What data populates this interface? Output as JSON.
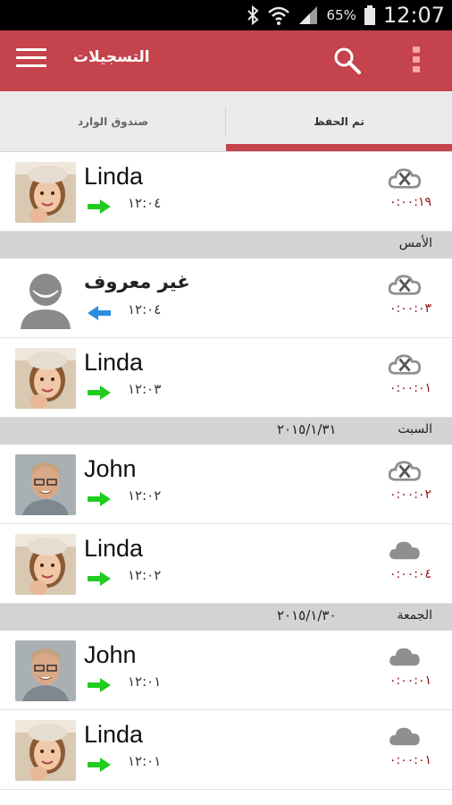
{
  "status_bar": {
    "time": "12:07",
    "battery": "65%"
  },
  "app_bar": {
    "title": "التسجيلات"
  },
  "tabs": [
    {
      "label": "صندوق الوارد",
      "selected": false
    },
    {
      "label": "تم الحفظ",
      "selected": true
    }
  ],
  "colors": {
    "accent": "#c5434c",
    "header_bg": "#d3d3d3",
    "duration": "#8e1010",
    "outgoing": "#20cc20",
    "incoming": "#2a8ee0",
    "cloud": "#8f8f8f"
  },
  "list": [
    {
      "type": "call",
      "name": "Linda",
      "time": "١٢:٠٤",
      "duration": "٠:٠٠:١٩",
      "direction": "outgoing",
      "cloud": "cloud-off-icon",
      "avatar": "linda"
    },
    {
      "type": "header",
      "day": "الأمس",
      "date": ""
    },
    {
      "type": "call",
      "name": "غير معروف",
      "time": "١٢:٠٤",
      "duration": "٠:٠٠:٠٣",
      "direction": "incoming",
      "cloud": "cloud-off-icon",
      "avatar": "unknown"
    },
    {
      "type": "call",
      "name": "Linda",
      "time": "١٢:٠٣",
      "duration": "٠:٠٠:٠١",
      "direction": "outgoing",
      "cloud": "cloud-off-icon",
      "avatar": "linda"
    },
    {
      "type": "header",
      "day": "السبت",
      "date": "٢٠١٥/١/٣١"
    },
    {
      "type": "call",
      "name": "John",
      "time": "١٢:٠٢",
      "duration": "٠:٠٠:٠٢",
      "direction": "outgoing",
      "cloud": "cloud-off-icon",
      "avatar": "john"
    },
    {
      "type": "call",
      "name": "Linda",
      "time": "١٢:٠٢",
      "duration": "٠:٠٠:٠٤",
      "direction": "outgoing",
      "cloud": "cloud-icon",
      "avatar": "linda"
    },
    {
      "type": "header",
      "day": "الجمعة",
      "date": "٢٠١٥/١/٣٠"
    },
    {
      "type": "call",
      "name": "John",
      "time": "١٢:٠١",
      "duration": "٠:٠٠:٠١",
      "direction": "outgoing",
      "cloud": "cloud-icon",
      "avatar": "john"
    },
    {
      "type": "call",
      "name": "Linda",
      "time": "١٢:٠١",
      "duration": "٠:٠٠:٠١",
      "direction": "outgoing",
      "cloud": "cloud-icon",
      "avatar": "linda"
    }
  ]
}
